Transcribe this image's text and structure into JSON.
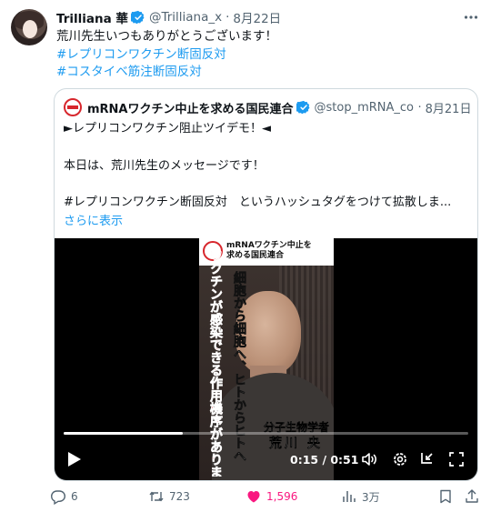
{
  "author": {
    "name": "Trilliana 華",
    "handle": "@Trilliana_x",
    "separator": "·",
    "date": "8月22日"
  },
  "tweet": {
    "text": "荒川先生いつもありがとうございます！",
    "hashtags": [
      "#レプリコンワクチン断固反対",
      "#コスタイベ筋注断固反対"
    ]
  },
  "quote": {
    "name": "mRNAワクチン中止を求める国民連合",
    "handle": "@stop_mRNA_cor",
    "separator": "·",
    "date": "8月21日",
    "lines": [
      "►レプリコンワクチン阻止ツイデモ！◄",
      "本日は、荒川先生のメッセージです！",
      "#レプリコンワクチン断固反対　というハッシュタグをつけて拡散しま..."
    ],
    "show_more": "さらに表示"
  },
  "video": {
    "banner_stop": "STOP",
    "banner_title_1": "mRNAワクチン中止を",
    "banner_title_2": "求める国民連合",
    "red_caption": "ワクチンが感染できる作用機序があります",
    "white_caption": "細胞から細胞へ、ヒトからヒトへ",
    "role": "分子生物学者",
    "speaker": "荒川 央",
    "current_time": "0:15",
    "duration": "0:51",
    "time_display": "0:15 / 0:51",
    "progress_fraction": 0.294
  },
  "actions": {
    "replies": "6",
    "retweets": "723",
    "likes": "1,596",
    "views": "3万"
  },
  "colors": {
    "accent": "#1d9bf0",
    "like": "#f91880",
    "muted": "#536471",
    "stop_red": "#d7262c"
  },
  "icons": [
    "verified-badge-icon",
    "more-icon",
    "play-icon",
    "volume-icon",
    "settings-icon",
    "minimize-icon",
    "fullscreen-icon",
    "reply-icon",
    "retweet-icon",
    "heart-icon",
    "views-icon",
    "bookmark-icon",
    "share-icon"
  ]
}
